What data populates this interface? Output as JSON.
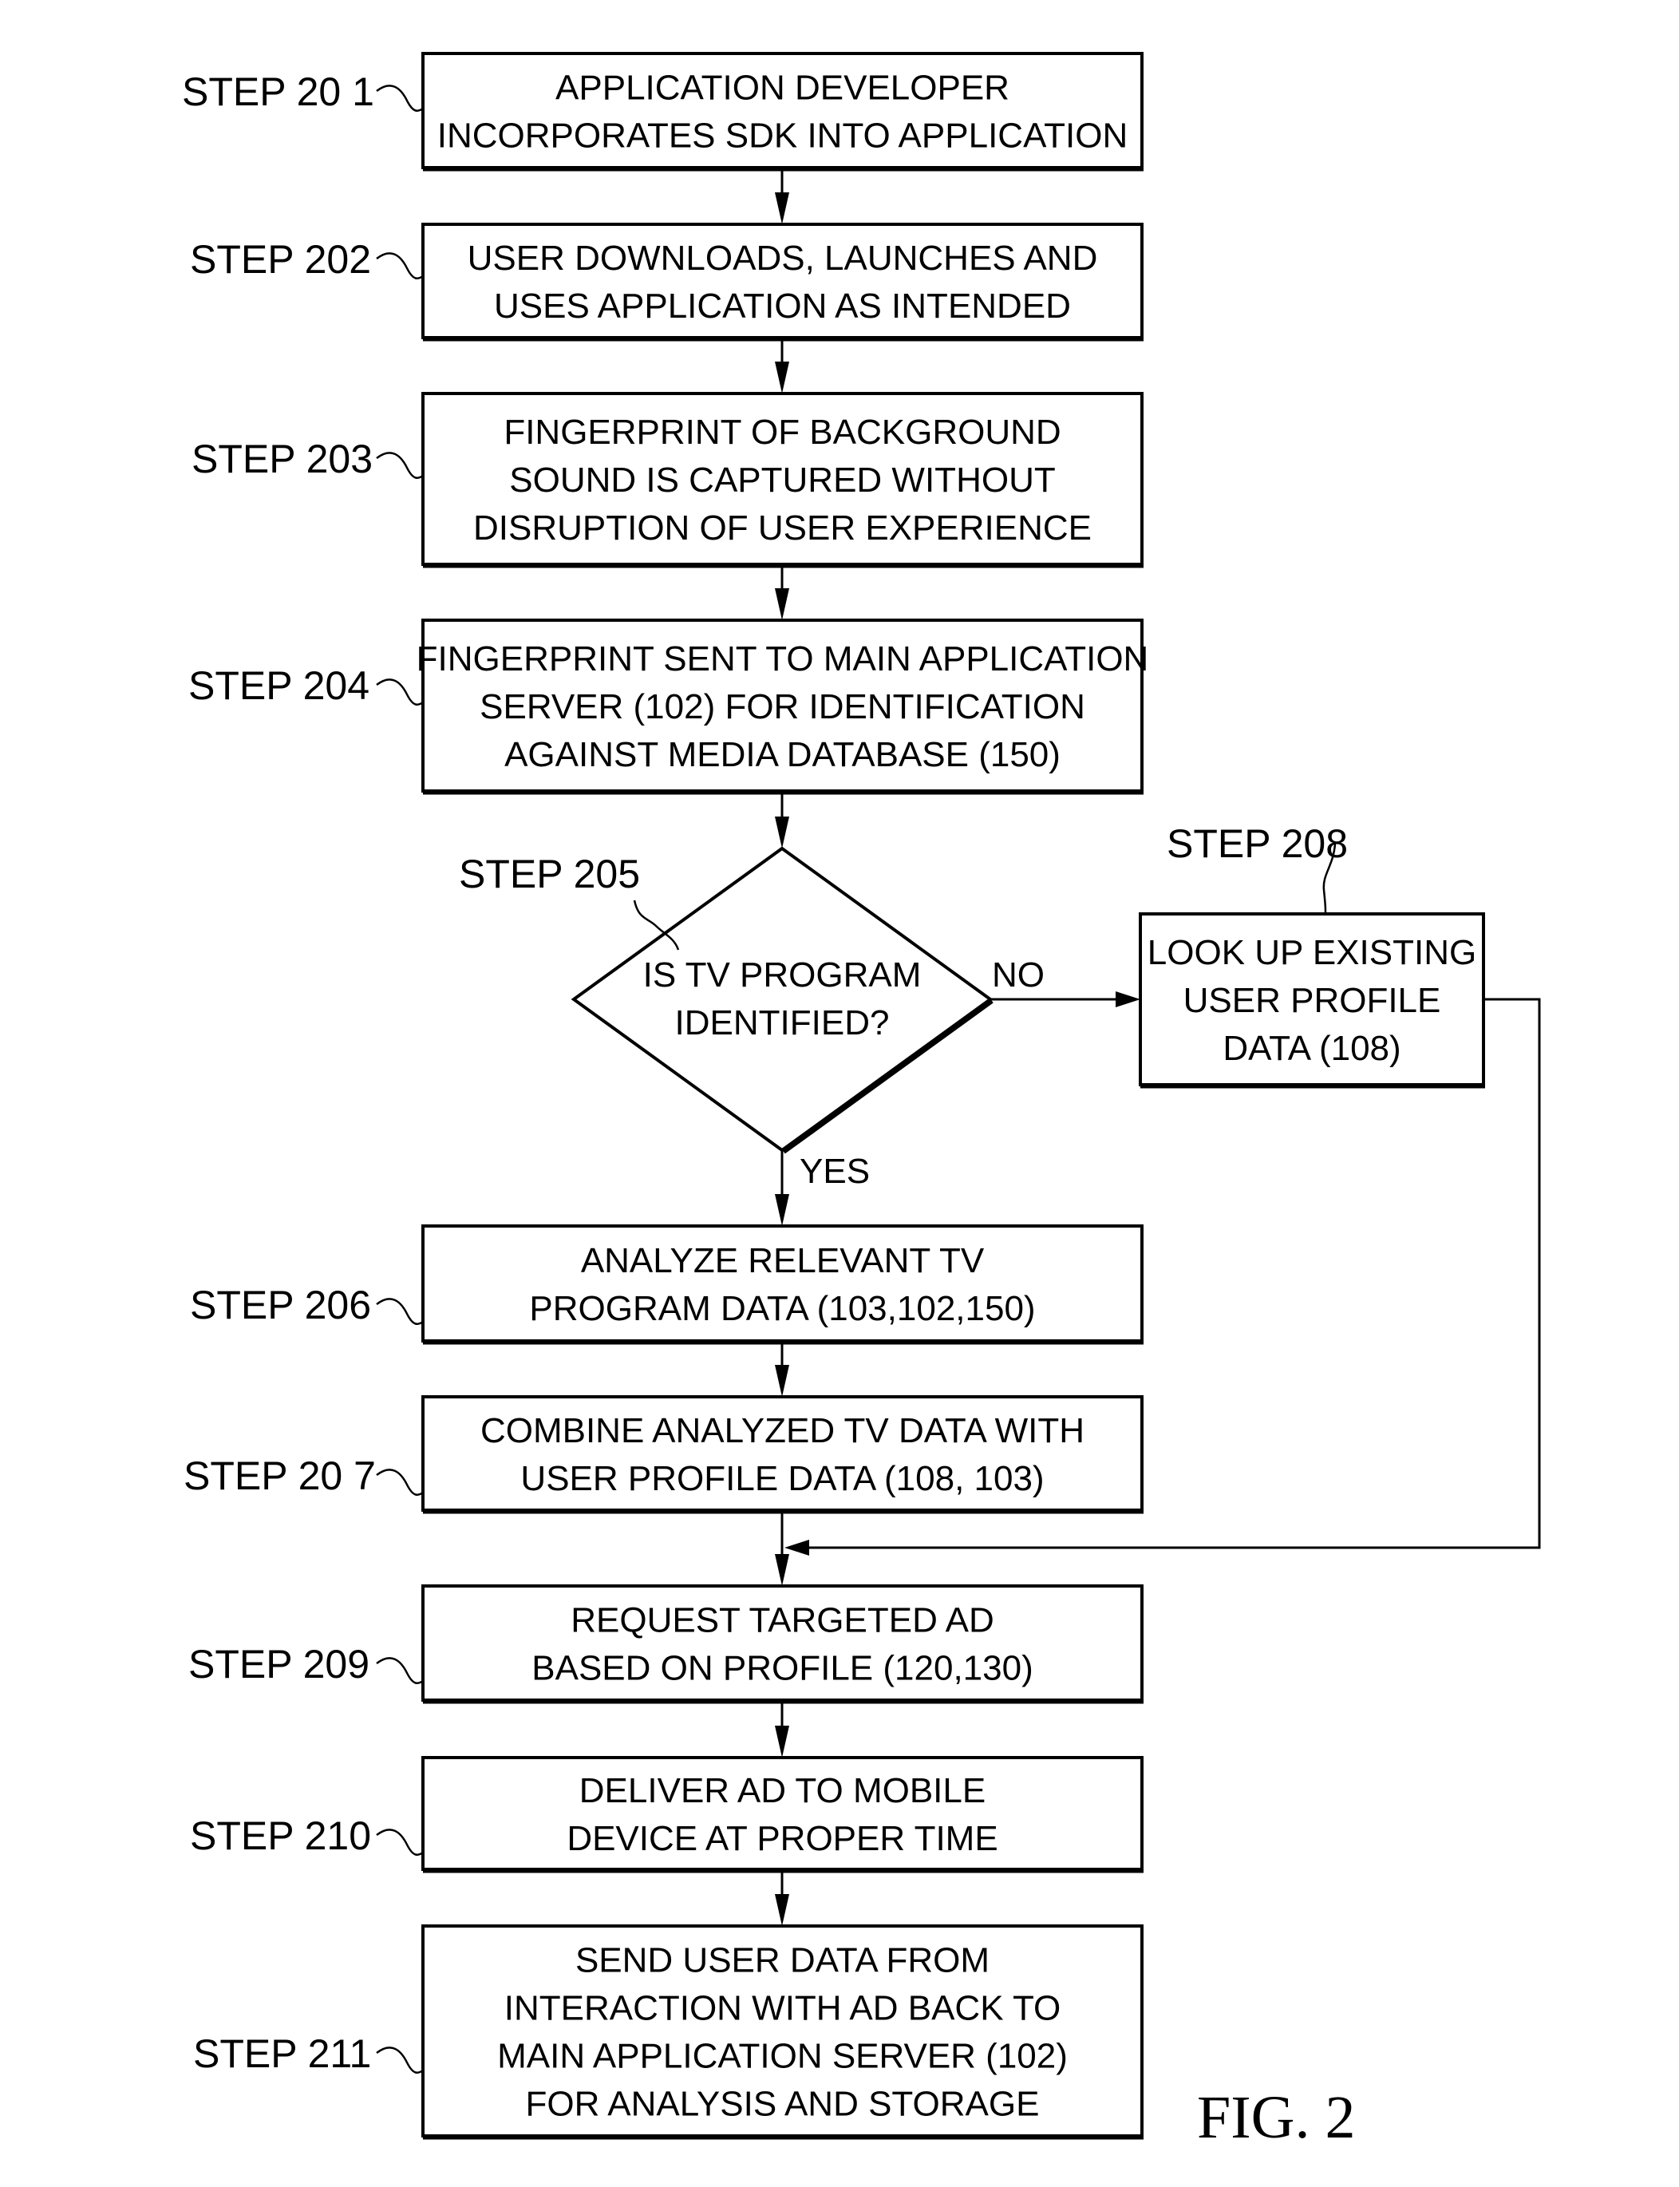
{
  "figure": {
    "label": "FIG. 2"
  },
  "steps": [
    {
      "id": "201",
      "label": "STEP  20 1",
      "lines": [
        "APPLICATION  DEVELOPER",
        "INCORPORATES SDK INTO APPLICATION"
      ]
    },
    {
      "id": "202",
      "label": "STEP 202",
      "lines": [
        "USER DOWNLOADS, LAUNCHES AND",
        "USES APPLICATION  AS INTENDED"
      ]
    },
    {
      "id": "203",
      "label": "STEP 203",
      "lines": [
        "FINGERPRINT OF BACKGROUND",
        "SOUND IS CAPTURED WITHOUT",
        "DISRUPTION OF USER EXPERIENCE"
      ]
    },
    {
      "id": "204",
      "label": "STEP 204",
      "lines": [
        "FINGERPRINT SENT TO MAIN APPLICATION",
        "SERVER (102) FOR IDENTIFICATION",
        "AGAINST MEDIA DATABASE (150)"
      ]
    },
    {
      "id": "205",
      "label": "STEP 205",
      "lines": [
        "IS TV PROGRAM",
        "IDENTIFIED?"
      ]
    },
    {
      "id": "208",
      "label": "STEP 208",
      "lines": [
        "LOOK UP EXISTING",
        "USER PROFILE",
        "DATA (108)"
      ]
    },
    {
      "id": "206",
      "label": "STEP 206",
      "lines": [
        "ANALYZE RELEVANT TV",
        "PROGRAM DATA (103,102,150)"
      ]
    },
    {
      "id": "207",
      "label": "STEP 20 7",
      "lines": [
        "COMBINE ANALYZED TV DATA WITH",
        "USER PROFILE DATA (108, 103)"
      ]
    },
    {
      "id": "209",
      "label": "STEP 209",
      "lines": [
        "REQUEST TARGETED AD",
        "BASED ON PROFILE (120,130)"
      ]
    },
    {
      "id": "210",
      "label": "STEP 210",
      "lines": [
        "DELIVER AD TO MOBILE",
        "DEVICE AT PROPER TIME"
      ]
    },
    {
      "id": "211",
      "label": "STEP 211",
      "lines": [
        "SEND USER DATA FROM",
        "INTERACTION WITH AD BACK TO",
        "MAIN APPLICATION SERVER (102)",
        "FOR ANALYSIS AND STORAGE"
      ]
    }
  ],
  "decision": {
    "yes_label": "YES",
    "no_label": "NO"
  },
  "colors": {
    "ink": "#000000",
    "paper": "#ffffff"
  }
}
